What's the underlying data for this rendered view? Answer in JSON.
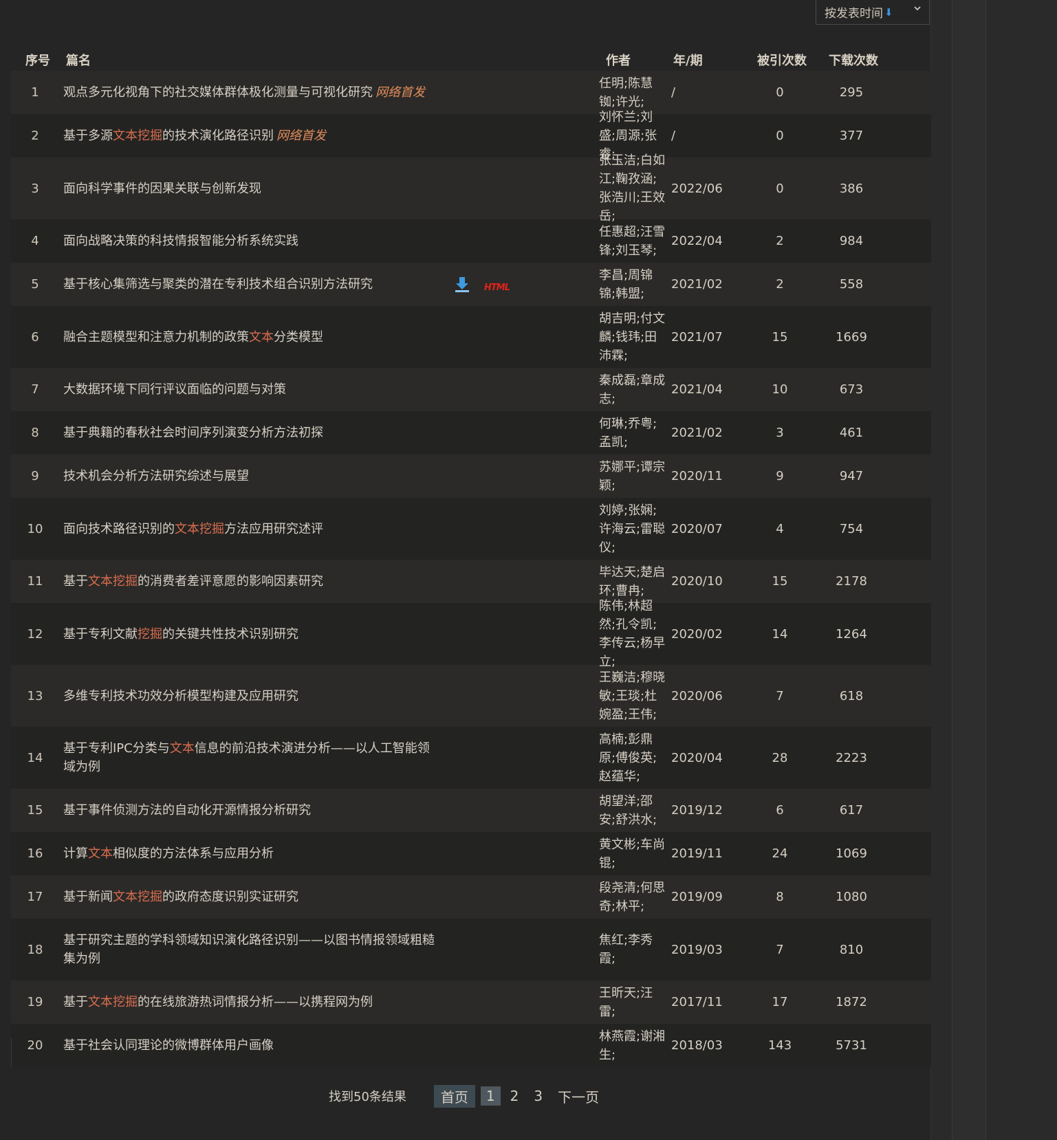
{
  "sort": {
    "label": "按发表时间",
    "arrow": "⬇"
  },
  "headers": {
    "no": "序号",
    "title": "篇名",
    "author": "作者",
    "date": "年/期",
    "cite": "被引次数",
    "download": "下载次数"
  },
  "rows": [
    {
      "no": "1",
      "title": [
        {
          "t": "观点多元化视角下的社交媒体群体极化测量与可视化研究"
        }
      ],
      "badge": "网络首发",
      "author": "任明;陈慧铷;许光;",
      "date": "/",
      "cite": "0",
      "dl": "295",
      "h": 63
    },
    {
      "no": "2",
      "title": [
        {
          "t": "基于多源"
        },
        {
          "t": "文本挖掘",
          "hl": true
        },
        {
          "t": "的技术演化路径识别"
        }
      ],
      "badge": "网络首发",
      "author": "刘怀兰;刘盛;周源;张睿;",
      "date": "/",
      "cite": "0",
      "dl": "377",
      "h": 63
    },
    {
      "no": "3",
      "title": [
        {
          "t": "面向科学事件的因果关联与创新发现"
        }
      ],
      "author": "张玉洁;白如江;鞠孜涵;张浩川;王效岳;",
      "date": "2022/06",
      "cite": "0",
      "dl": "386",
      "h": 90
    },
    {
      "no": "4",
      "title": [
        {
          "t": "面向战略决策的科技情报智能分析系统实践"
        }
      ],
      "author": "任惠超;汪雪锋;刘玉琴;",
      "date": "2022/04",
      "cite": "2",
      "dl": "984",
      "h": 63
    },
    {
      "no": "5",
      "title": [
        {
          "t": "基于核心集筛选与聚类的潜在专利技术组合识别方法研究"
        }
      ],
      "icons": true,
      "html_label": "HTML",
      "author": "李昌;周锦锦;韩盟;",
      "date": "2021/02",
      "cite": "2",
      "dl": "558",
      "h": 63
    },
    {
      "no": "6",
      "title": [
        {
          "t": "融合主题模型和注意力机制的政策"
        },
        {
          "t": "文本",
          "hl": true
        },
        {
          "t": "分类模型"
        }
      ],
      "author": "胡吉明;付文麟;钱玮;田沛霖;",
      "date": "2021/07",
      "cite": "15",
      "dl": "1669",
      "h": 90
    },
    {
      "no": "7",
      "title": [
        {
          "t": "大数据环境下同行评议面临的问题与对策"
        }
      ],
      "author": "秦成磊;章成志;",
      "date": "2021/04",
      "cite": "10",
      "dl": "673",
      "h": 63
    },
    {
      "no": "8",
      "title": [
        {
          "t": "基于典籍的春秋社会时间序列演变分析方法初探"
        }
      ],
      "author": "何琳;乔粤;孟凯;",
      "date": "2021/02",
      "cite": "3",
      "dl": "461",
      "h": 63
    },
    {
      "no": "9",
      "title": [
        {
          "t": "技术机会分析方法研究综述与展望"
        }
      ],
      "author": "苏娜平;谭宗颖;",
      "date": "2020/11",
      "cite": "9",
      "dl": "947",
      "h": 63
    },
    {
      "no": "10",
      "title": [
        {
          "t": "面向技术路径识别的"
        },
        {
          "t": "文本挖掘",
          "hl": true
        },
        {
          "t": "方法应用研究述评"
        }
      ],
      "author": "刘婷;张娴;许海云;雷聪仪;",
      "date": "2020/07",
      "cite": "4",
      "dl": "754",
      "h": 90
    },
    {
      "no": "11",
      "title": [
        {
          "t": "基于"
        },
        {
          "t": "文本挖掘",
          "hl": true
        },
        {
          "t": "的消费者差评意愿的影响因素研究"
        }
      ],
      "author": "毕达天;楚启环;曹冉;",
      "date": "2020/10",
      "cite": "15",
      "dl": "2178",
      "h": 63
    },
    {
      "no": "12",
      "title": [
        {
          "t": "基于专利文献"
        },
        {
          "t": "挖掘",
          "hl": true
        },
        {
          "t": "的关键共性技术识别研究"
        }
      ],
      "author": "陈伟;林超然;孔令凯;李传云;杨早立;",
      "date": "2020/02",
      "cite": "14",
      "dl": "1264",
      "h": 90
    },
    {
      "no": "13",
      "title": [
        {
          "t": "多维专利技术功效分析模型构建及应用研究"
        }
      ],
      "author": "王巍洁;穆晓敏;王琰;杜婉盈;王伟;",
      "date": "2020/06",
      "cite": "7",
      "dl": "618",
      "h": 90
    },
    {
      "no": "14",
      "title": [
        {
          "t": "基于专利IPC分类与"
        },
        {
          "t": "文本",
          "hl": true
        },
        {
          "t": "信息的前沿技术演进分析——以人工智能领域为例"
        }
      ],
      "author": "高楠;彭鼎原;傅俊英;赵蕴华;",
      "date": "2020/04",
      "cite": "28",
      "dl": "2223",
      "h": 90
    },
    {
      "no": "15",
      "title": [
        {
          "t": "基于事件侦测方法的自动化开源情报分析研究"
        }
      ],
      "author": "胡望洋;邵安;舒洪水;",
      "date": "2019/12",
      "cite": "6",
      "dl": "617",
      "h": 63
    },
    {
      "no": "16",
      "title": [
        {
          "t": "计算"
        },
        {
          "t": "文本",
          "hl": true
        },
        {
          "t": "相似度的方法体系与应用分析"
        }
      ],
      "author": "黄文彬;车尚锟;",
      "date": "2019/11",
      "cite": "24",
      "dl": "1069",
      "h": 63
    },
    {
      "no": "17",
      "title": [
        {
          "t": "基于新闻"
        },
        {
          "t": "文本挖掘",
          "hl": true
        },
        {
          "t": "的政府态度识别实证研究"
        }
      ],
      "author": "段尧清;何思奇;林平;",
      "date": "2019/09",
      "cite": "8",
      "dl": "1080",
      "h": 63
    },
    {
      "no": "18",
      "title": [
        {
          "t": "基于研究主题的学科领域知识演化路径识别——以图书情报领域粗糙集为例"
        }
      ],
      "author": "焦红;李秀霞;",
      "date": "2019/03",
      "cite": "7",
      "dl": "810",
      "h": 90
    },
    {
      "no": "19",
      "title": [
        {
          "t": "基于"
        },
        {
          "t": "文本挖掘",
          "hl": true
        },
        {
          "t": "的在线旅游热词情报分析——以携程网为例"
        }
      ],
      "author": "王昕天;汪雷;",
      "date": "2017/11",
      "cite": "17",
      "dl": "1872",
      "h": 63
    },
    {
      "no": "20",
      "title": [
        {
          "t": "基于社会认同理论的微博群体用户画像"
        }
      ],
      "author": "林燕霞;谢湘生;",
      "date": "2018/03",
      "cite": "143",
      "dl": "5731",
      "h": 63
    }
  ],
  "pager": {
    "count": "找到50条结果",
    "first": "首页",
    "current": "1",
    "p2": "2",
    "p3": "3",
    "next": "下一页"
  }
}
